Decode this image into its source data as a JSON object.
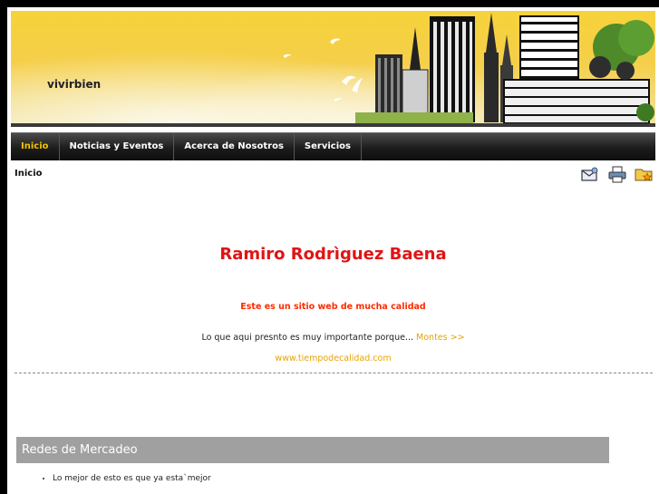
{
  "header": {
    "site_name": "vivirbien"
  },
  "nav": {
    "items": [
      {
        "label": "Inicio",
        "active": true
      },
      {
        "label": "Noticias y Eventos",
        "active": false
      },
      {
        "label": "Acerca de Nosotros",
        "active": false
      },
      {
        "label": "Servicios",
        "active": false
      }
    ]
  },
  "breadcrumb": "Inicio",
  "tools": {
    "icons": [
      "email-icon",
      "print-icon",
      "favorite-icon"
    ]
  },
  "article": {
    "title": "Ramiro Rodrìguez Baena",
    "subtitle": "Este es un sitio web de mucha calidad",
    "intro_text": "Lo que aqui presnto es muy importante porque...",
    "read_more": "Montes >>",
    "site_link": "www.tiempodecalidad.com"
  },
  "module": {
    "title": "Redes de Mercadeo",
    "items": [
      "Lo mejor de esto es que ya esta`mejor"
    ]
  },
  "colors": {
    "title_red": "#e01414",
    "subtitle_orange": "#ff2a00",
    "link_gold": "#e6a300",
    "nav_active": "#f2c300",
    "module_header": "#a0a0a0"
  }
}
